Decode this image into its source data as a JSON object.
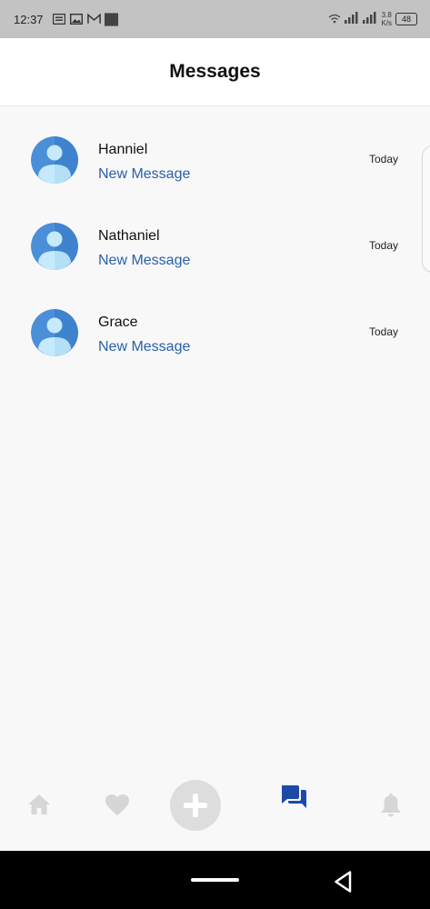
{
  "status_bar": {
    "time": "12:37",
    "speed_value": "3.8",
    "speed_unit": "K/s",
    "battery": "48"
  },
  "header": {
    "title": "Messages"
  },
  "messages": [
    {
      "name": "Hanniel",
      "preview": "New Message",
      "time": "Today"
    },
    {
      "name": "Nathaniel",
      "preview": "New Message",
      "time": "Today"
    },
    {
      "name": "Grace",
      "preview": "New Message",
      "time": "Today"
    }
  ],
  "bottom_nav": {
    "items": [
      "home-icon",
      "heart-icon",
      "add-icon",
      "messages-icon",
      "bell-icon"
    ],
    "active": "messages-icon"
  },
  "colors": {
    "accent": "#1c4aa6",
    "preview_text": "#2a5fa8",
    "inactive_icon": "#d6d6d6",
    "avatar_dark": "#4a8fd8",
    "avatar_light": "#c6eafc"
  }
}
